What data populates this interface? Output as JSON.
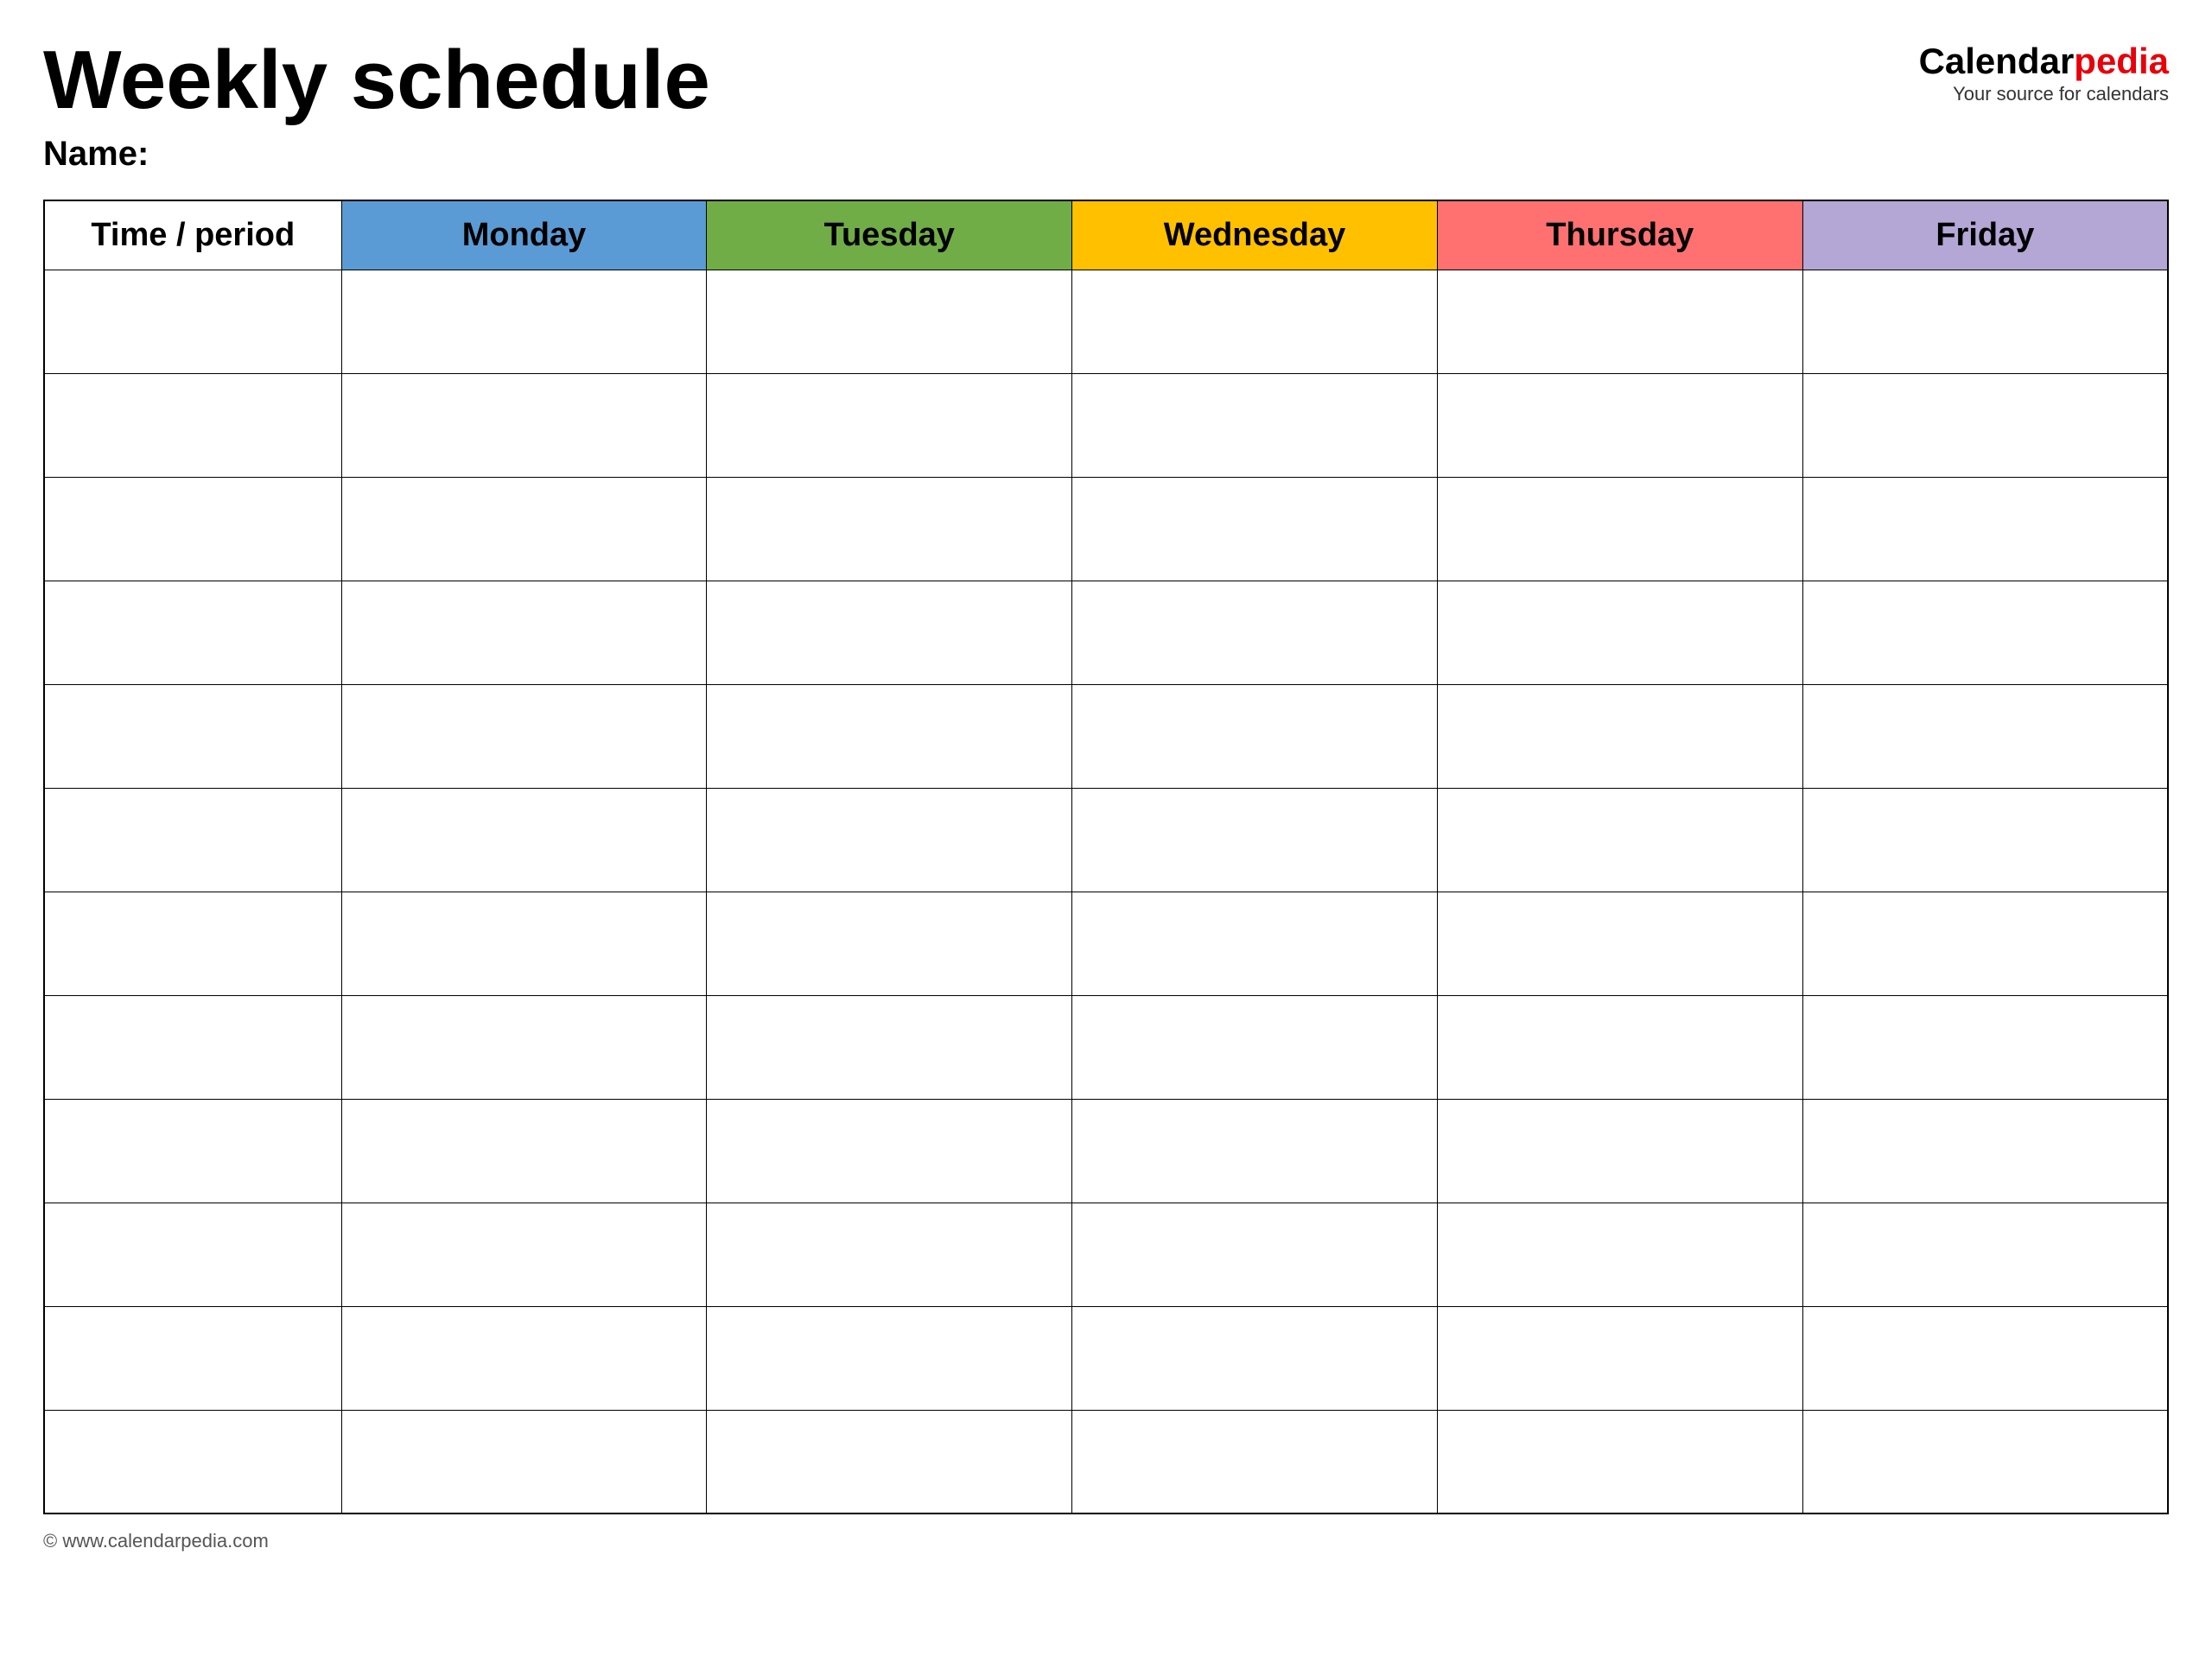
{
  "header": {
    "title": "Weekly schedule",
    "name_label": "Name:",
    "brand": {
      "name_part1": "Calendar",
      "name_part2": "pedia",
      "tagline": "Your source for calendars"
    }
  },
  "table": {
    "columns": [
      {
        "key": "time",
        "label": "Time / period",
        "class": "th-time col-time"
      },
      {
        "key": "monday",
        "label": "Monday",
        "class": "th-monday col-day"
      },
      {
        "key": "tuesday",
        "label": "Tuesday",
        "class": "th-tuesday col-day"
      },
      {
        "key": "wednesday",
        "label": "Wednesday",
        "class": "th-wednesday col-day"
      },
      {
        "key": "thursday",
        "label": "Thursday",
        "class": "th-thursday col-day"
      },
      {
        "key": "friday",
        "label": "Friday",
        "class": "th-friday col-day"
      }
    ],
    "row_count": 12
  },
  "footer": {
    "url": "© www.calendarpedia.com"
  }
}
